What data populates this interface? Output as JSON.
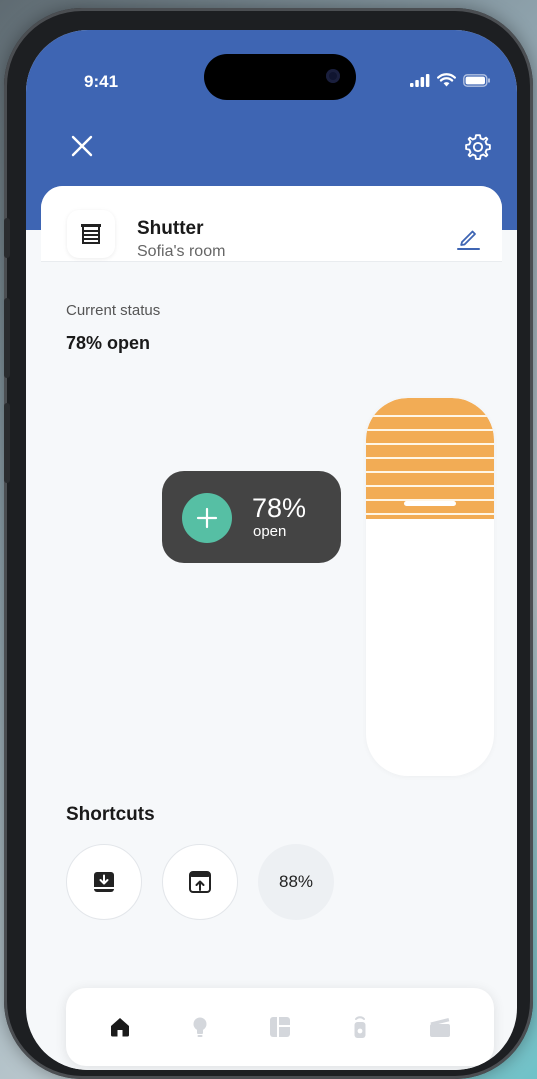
{
  "status_bar": {
    "time": "9:41"
  },
  "icons": {
    "close": "close-icon",
    "settings": "gear-icon",
    "device": "shutter-icon",
    "edit": "pencil-icon"
  },
  "device": {
    "name": "Shutter",
    "room": "Sofia's room"
  },
  "status": {
    "label": "Current status",
    "value": "78% open",
    "open_fraction": 0.78
  },
  "tooltip": {
    "percent": "78%",
    "state": "open"
  },
  "shortcuts": {
    "title": "Shortcuts",
    "items": [
      {
        "icon": "close-shutter-icon"
      },
      {
        "icon": "open-shutter-icon"
      },
      {
        "label": "88%"
      }
    ]
  },
  "tabs": [
    {
      "icon": "home-icon",
      "active": true
    },
    {
      "icon": "bulb-icon",
      "active": false
    },
    {
      "icon": "shutter-tab-icon",
      "active": false
    },
    {
      "icon": "remote-icon",
      "active": false
    },
    {
      "icon": "scene-icon",
      "active": false
    }
  ],
  "colors": {
    "header": "#3e65b3",
    "accent": "#56bfa4",
    "shutter": "#f2ac55",
    "tooltip": "#444444",
    "tab_active": "#1a1a1a",
    "tab_inactive": "#d4d7dc"
  }
}
